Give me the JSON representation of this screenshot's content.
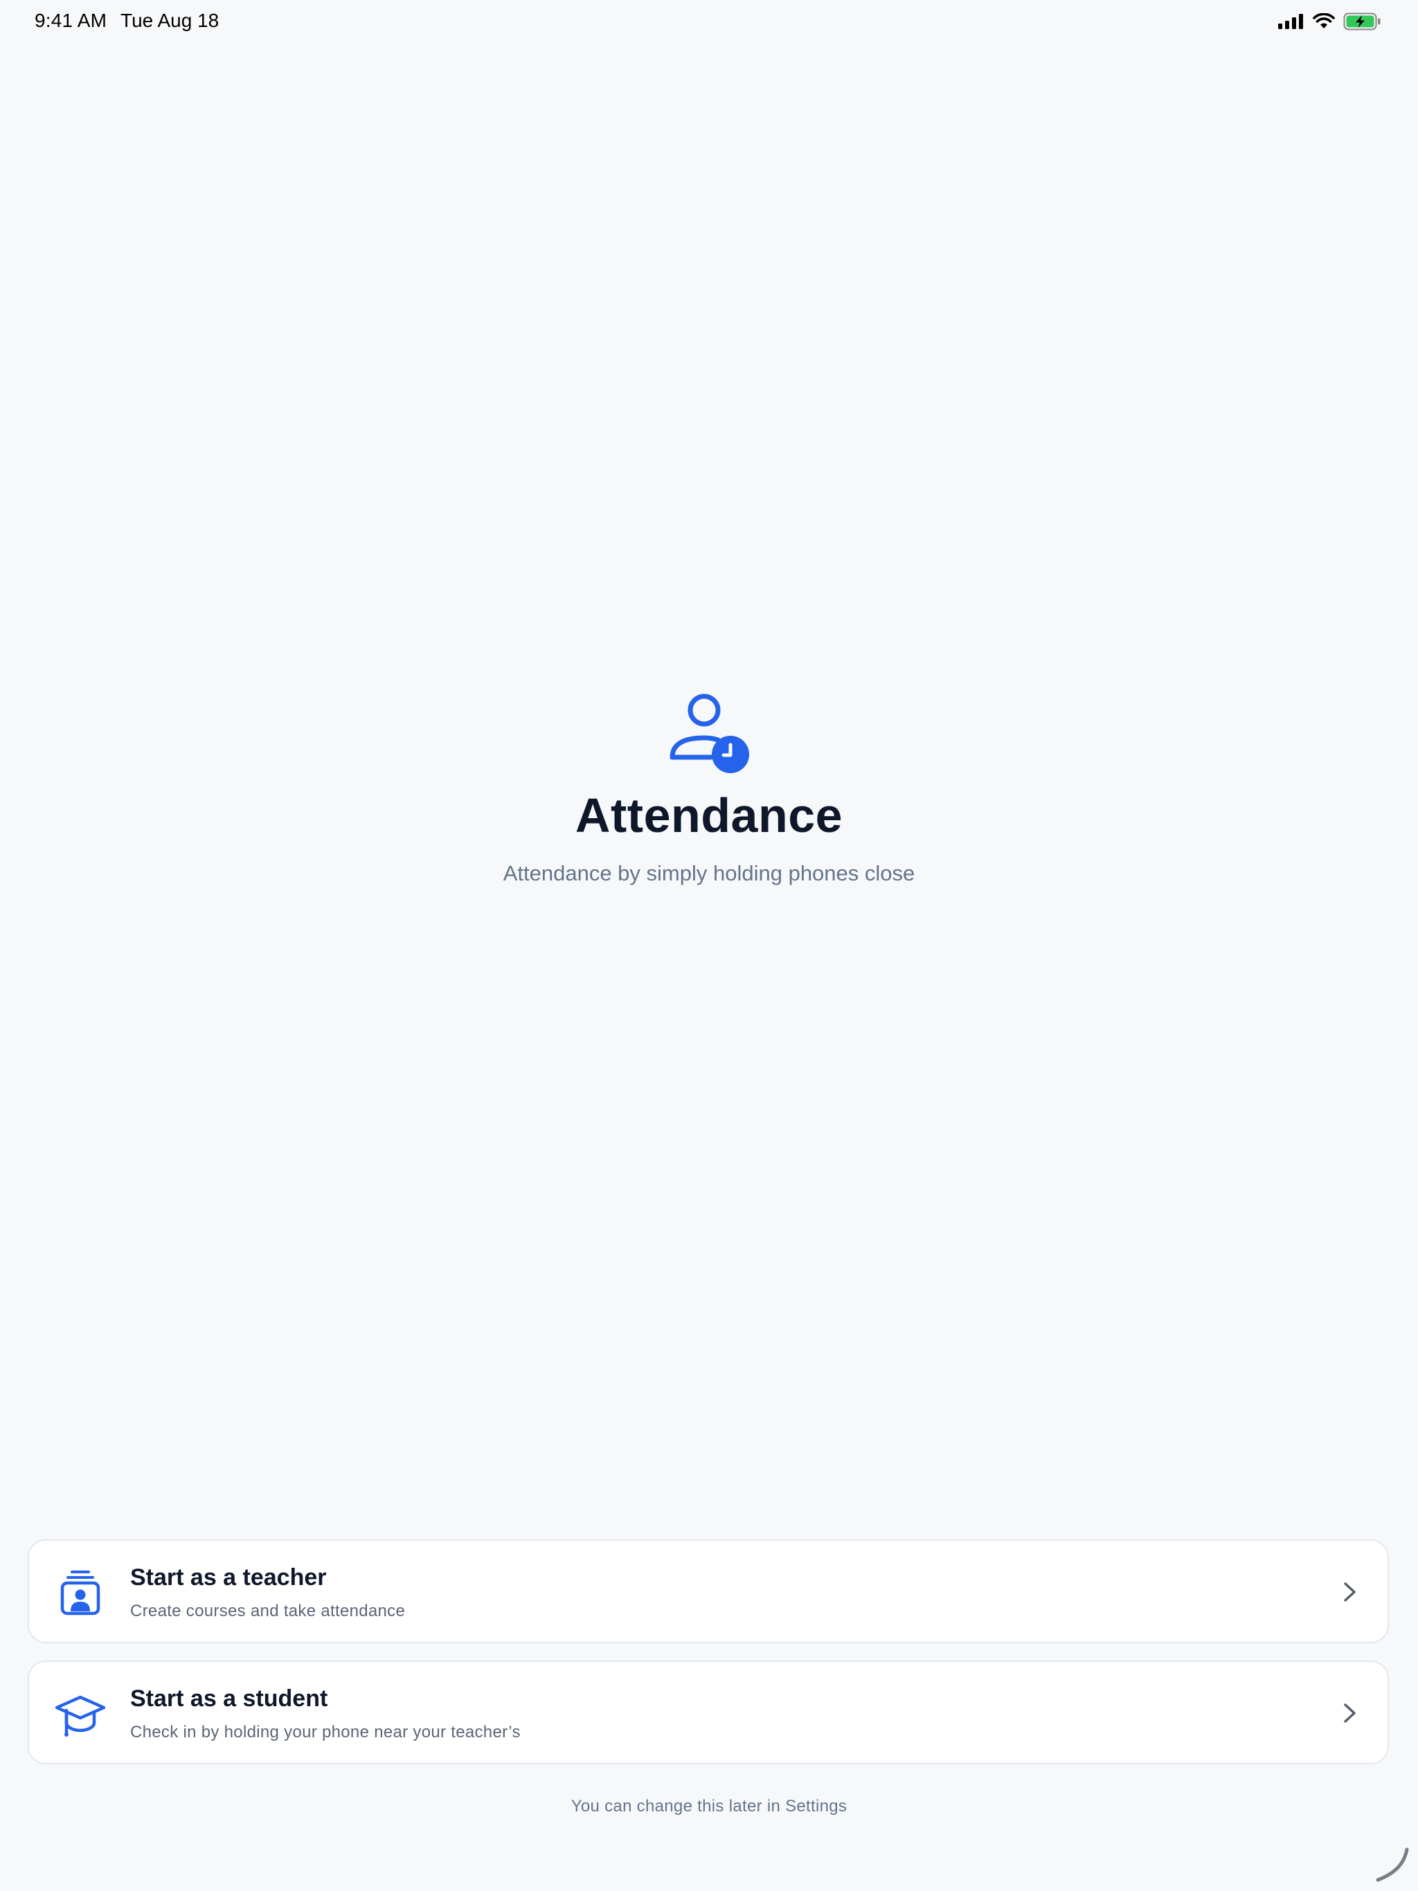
{
  "status_bar": {
    "time": "9:41 AM",
    "date": "Tue Aug 18"
  },
  "hero": {
    "icon": "user-clock-icon",
    "title": "Attendance",
    "subtitle": "Attendance by simply holding phones close"
  },
  "roles": [
    {
      "icon": "teacher-badge-icon",
      "title": "Start as a teacher",
      "description": "Create courses and take attendance"
    },
    {
      "icon": "graduation-cap-icon",
      "title": "Start as a student",
      "description": "Check in by holding your phone near your teacher’s"
    }
  ],
  "footnote": "You can change this later in Settings",
  "colors": {
    "accent": "#2563eb",
    "background": "#f7f8fa",
    "card": "#ffffff",
    "title": "#0f172a",
    "muted": "#64748b",
    "battery": "#34c759"
  }
}
